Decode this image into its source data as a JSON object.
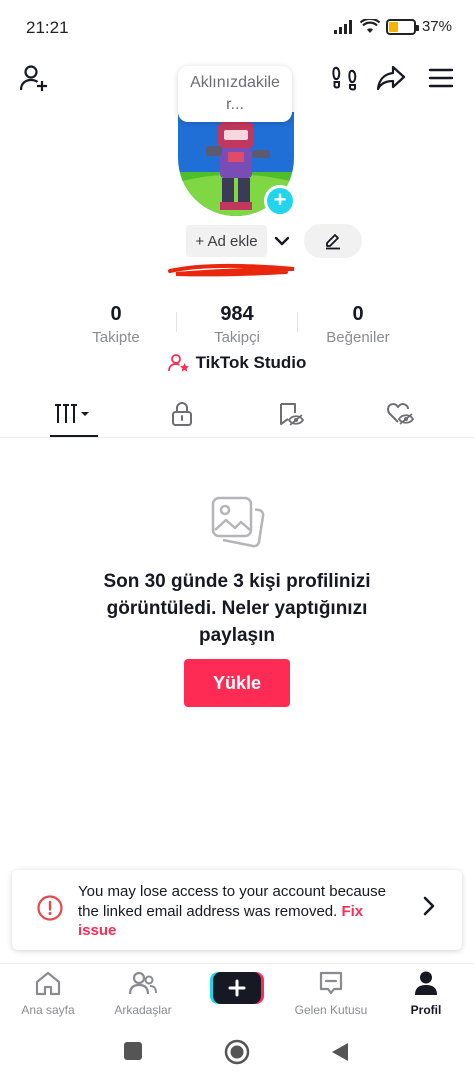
{
  "status_bar": {
    "time": "21:21",
    "battery_percent": "37%",
    "battery_level": 0.37,
    "battery_color": "#f4b400"
  },
  "header": {
    "add_friend_icon": "person-plus-icon",
    "footprints_icon": "footprints-icon",
    "share_icon": "share-arrow-icon",
    "menu_icon": "hamburger-menu-icon"
  },
  "profile": {
    "thought_bubble": "Aklınızdakiler...",
    "add_name_label": "+ Ad ekle",
    "edit_icon": "pencil-icon"
  },
  "stats": [
    {
      "value": "0",
      "label": "Takipte"
    },
    {
      "value": "984",
      "label": "Takipçi"
    },
    {
      "value": "0",
      "label": "Beğeniler"
    }
  ],
  "studio": {
    "label": "TikTok Studio"
  },
  "tabs": [
    {
      "name": "videos",
      "icon": "grid-bars-icon",
      "active": true
    },
    {
      "name": "private",
      "icon": "lock-icon",
      "active": false
    },
    {
      "name": "saved-hidden",
      "icon": "bookmark-eye-icon",
      "active": false
    },
    {
      "name": "liked-hidden",
      "icon": "heart-eye-icon",
      "active": false
    }
  ],
  "empty_state": {
    "message": "Son 30 günde 3 kişi profilinizi görüntüledi. Neler yaptığınızı paylaşın",
    "upload_button": "Yükle"
  },
  "warning": {
    "message": "You may lose access to your account because the linked email address was removed.",
    "link": "Fix issue"
  },
  "bottom_nav": [
    {
      "label": "Ana sayfa",
      "icon": "home-icon"
    },
    {
      "label": "Arkadaşlar",
      "icon": "friends-icon"
    },
    {
      "label": "",
      "icon": "create-plus-icon"
    },
    {
      "label": "Gelen Kutusu",
      "icon": "inbox-icon"
    },
    {
      "label": "Profil",
      "icon": "profile-icon",
      "active": true
    }
  ],
  "colors": {
    "accent": "#fe2c55",
    "teal": "#20d5ec",
    "text": "#161823",
    "muted": "#8a8b91"
  }
}
